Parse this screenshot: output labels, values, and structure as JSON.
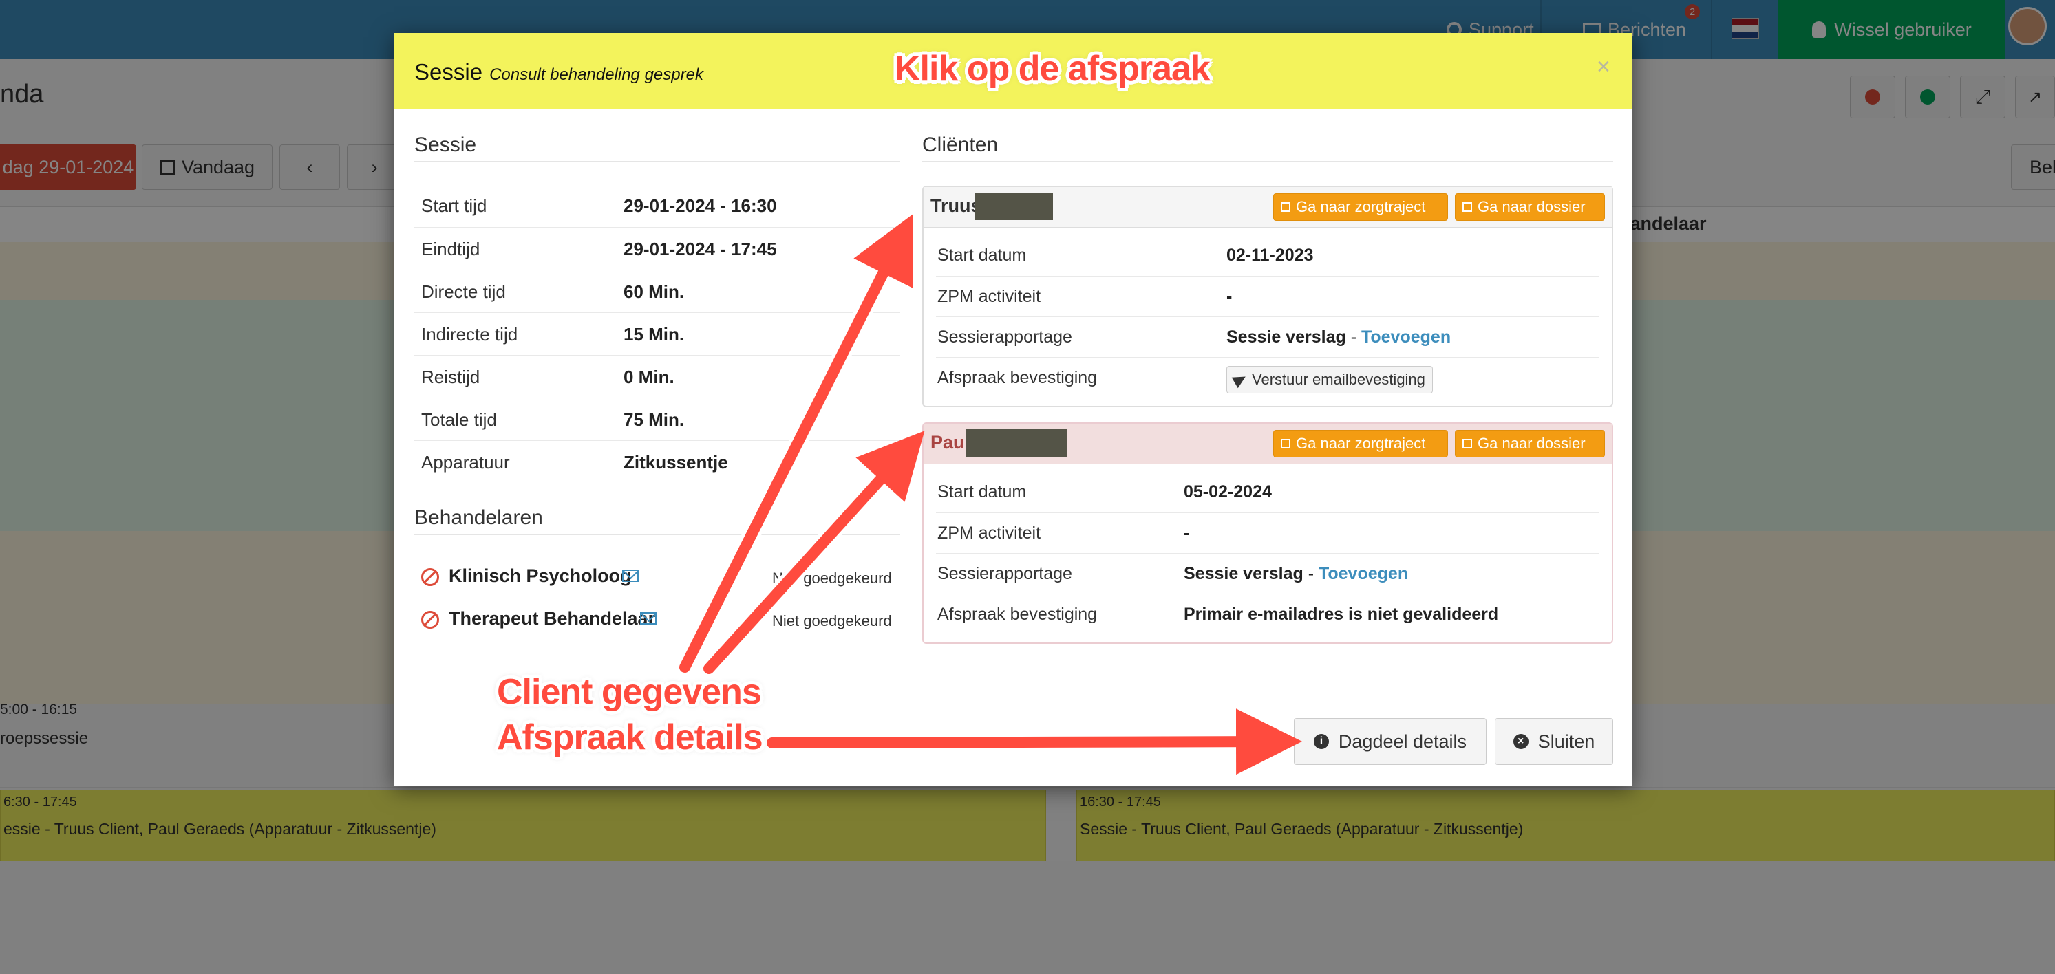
{
  "topnav": {
    "support": "Support",
    "messages": "Berichten",
    "messages_badge": "2",
    "switch_user": "Wissel gebruiker"
  },
  "background": {
    "page_title": "nda",
    "day_button": "dag 29-01-2024",
    "today_button": "Vandaag",
    "right_partial_button": "Bek",
    "column_header": "handelaar",
    "event_small_time": "5:00 - 16:15",
    "event_small_label": "roepssessie",
    "event_left_time": "6:30 - 17:45",
    "event_left_desc": "essie - Truus Client, Paul Geraeds (Apparatuur - Zitkussentje)",
    "event_right_time": "16:30 - 17:45",
    "event_right_desc": "Sessie - Truus Client, Paul Geraeds (Apparatuur - Zitkussentje)"
  },
  "modal": {
    "title": "Sessie",
    "subtitle": "Consult behandeling gesprek",
    "close_glyph": "×",
    "session_heading": "Sessie",
    "session_rows": [
      {
        "label": "Start tijd",
        "value": "29-01-2024 - 16:30"
      },
      {
        "label": "Eindtijd",
        "value": "29-01-2024 - 17:45"
      },
      {
        "label": "Directe tijd",
        "value": "60 Min."
      },
      {
        "label": "Indirecte tijd",
        "value": "15 Min."
      },
      {
        "label": "Reistijd",
        "value": "0 Min."
      },
      {
        "label": "Totale tijd",
        "value": "75 Min."
      },
      {
        "label": "Apparatuur",
        "value": "Zitkussentje"
      }
    ],
    "practitioners_heading": "Behandelaren",
    "practitioners": [
      {
        "name": "Klinisch Psycholoog",
        "status": "Niet goedgekeurd"
      },
      {
        "name": "Therapeut Behandelaar",
        "status": "Niet goedgekeurd"
      }
    ],
    "clients_heading": "Cliënten",
    "clients": [
      {
        "name": "Truus",
        "btn_trajectory": "Ga naar zorgtraject",
        "btn_dossier": "Ga naar dossier",
        "start_label": "Start datum",
        "start_value": "02-11-2023",
        "zpm_label": "ZPM activiteit",
        "zpm_value": "-",
        "report_label": "Sessierapportage",
        "report_value": "Sessie verslag",
        "report_sep": " - ",
        "report_link": "Toevoegen",
        "confirm_label": "Afspraak bevestiging",
        "confirm_button": "Verstuur emailbevestiging"
      },
      {
        "name": "Paul",
        "btn_trajectory": "Ga naar zorgtraject",
        "btn_dossier": "Ga naar dossier",
        "start_label": "Start datum",
        "start_value": "05-02-2024",
        "zpm_label": "ZPM activiteit",
        "zpm_value": "-",
        "report_label": "Sessierapportage",
        "report_value": "Sessie verslag",
        "report_sep": " - ",
        "report_link": "Toevoegen",
        "confirm_label": "Afspraak bevestiging",
        "confirm_error": "Primair e-mailadres is niet gevalideerd"
      }
    ],
    "footer": {
      "details_button": "Dagdeel details",
      "close_button": "Sluiten"
    }
  },
  "annotations": {
    "top": "Klik op de afspraak",
    "bottom_line1": "Client gegevens",
    "bottom_line2": "Afspraak details"
  },
  "colors": {
    "nav": "#3c8dbc",
    "switch_user": "#00a65a",
    "modal_header": "#f3f35c",
    "orange_button": "#f39c12",
    "danger": "#dd4b39",
    "annotation": "#ff4b3e"
  }
}
